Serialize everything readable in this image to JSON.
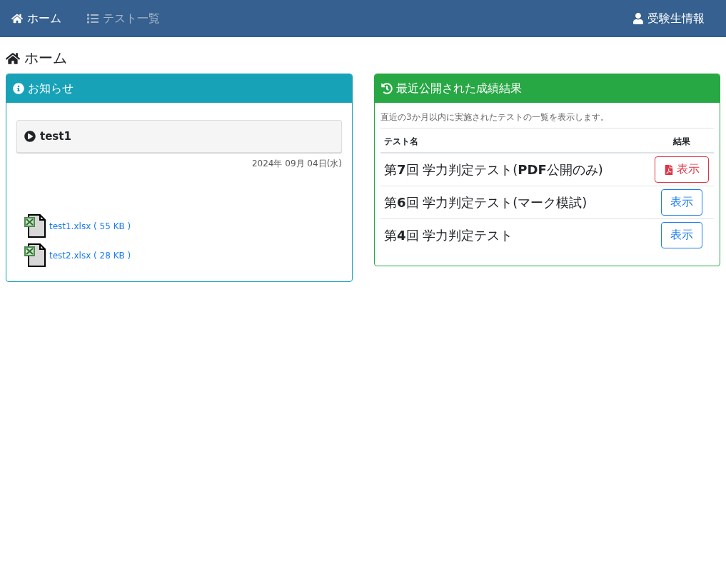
{
  "navbar": {
    "items": [
      {
        "label": "ホーム",
        "kind": "home",
        "selected": true
      },
      {
        "label": "テスト一覧",
        "kind": "list",
        "selected": false
      }
    ],
    "user": {
      "label": "受験生情報"
    }
  },
  "page_title": "ホーム",
  "notice_card": {
    "title": "お知らせ",
    "notices": [
      {
        "title": "test1",
        "date": "2024年 09月 04日(水)",
        "files": [
          {
            "label": "test1.xlsx ( 55 KB )"
          },
          {
            "label": "test2.xlsx ( 28 KB )"
          }
        ]
      }
    ]
  },
  "results_card": {
    "title": "最近公開された成績結果",
    "description": "直近の3か月以内に実施されたテストの一覧を表示します。",
    "columns": [
      "テスト名",
      "結果"
    ],
    "rows": [
      {
        "name": "第**7**回 学力判定テスト(**PDF**公開のみ)",
        "button": "表示",
        "kind": "pdf"
      },
      {
        "name": "第**6**回 学力判定テスト(マーク模試)",
        "button": "表示",
        "kind": "plain"
      },
      {
        "name": "第**4**回 学力判定テスト",
        "button": "表示",
        "kind": "plain"
      }
    ]
  }
}
